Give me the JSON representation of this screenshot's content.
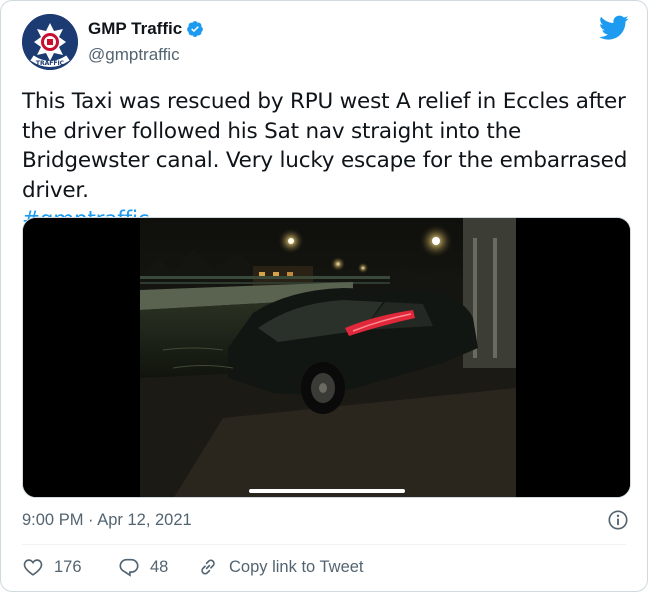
{
  "account": {
    "display_name": "GMP Traffic",
    "handle": "@gmptraffic",
    "avatar_text": "TRAFFIC",
    "verified": true
  },
  "tweet": {
    "text": "This Taxi was rescued by RPU west A relief in Eccles after the driver followed his Sat nav straight into the Bridgewster canal. Very lucky escape for the embarrased driver.",
    "hashtag": "#gmptraffic",
    "timestamp": "9:00 PM · Apr 12, 2021"
  },
  "media": {
    "type": "video"
  },
  "actions": {
    "likes": "176",
    "replies": "48",
    "copy_link_label": "Copy link to Tweet"
  },
  "colors": {
    "accent": "#1d9bf0",
    "secondary_text": "#536471",
    "primary_text": "#0f1419"
  },
  "icons": [
    "gmp-crest-icon",
    "verified-badge-icon",
    "twitter-bird-icon",
    "info-icon",
    "heart-icon",
    "reply-icon",
    "link-icon"
  ]
}
